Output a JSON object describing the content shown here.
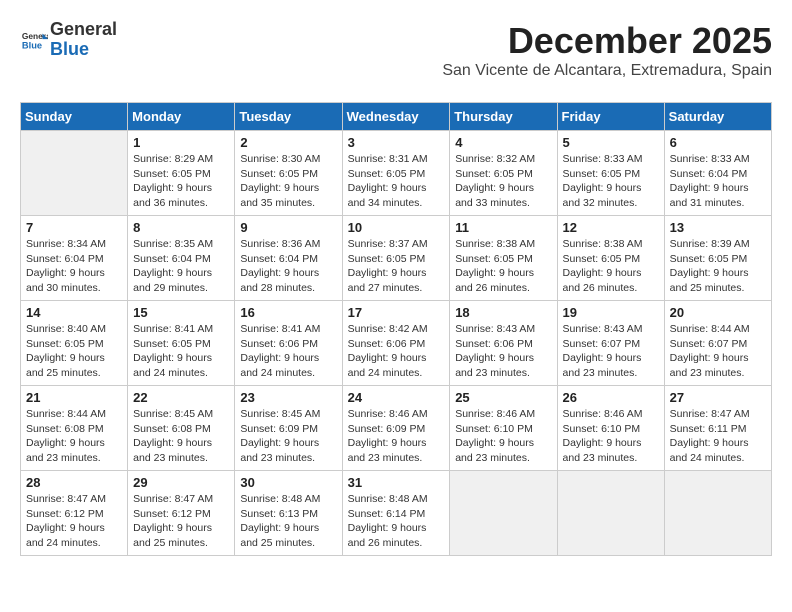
{
  "header": {
    "logo_general": "General",
    "logo_blue": "Blue",
    "month_title": "December 2025",
    "location": "San Vicente de Alcantara, Extremadura, Spain"
  },
  "weekdays": [
    "Sunday",
    "Monday",
    "Tuesday",
    "Wednesday",
    "Thursday",
    "Friday",
    "Saturday"
  ],
  "weeks": [
    [
      {
        "day": "",
        "info": ""
      },
      {
        "day": "1",
        "info": "Sunrise: 8:29 AM\nSunset: 6:05 PM\nDaylight: 9 hours\nand 36 minutes."
      },
      {
        "day": "2",
        "info": "Sunrise: 8:30 AM\nSunset: 6:05 PM\nDaylight: 9 hours\nand 35 minutes."
      },
      {
        "day": "3",
        "info": "Sunrise: 8:31 AM\nSunset: 6:05 PM\nDaylight: 9 hours\nand 34 minutes."
      },
      {
        "day": "4",
        "info": "Sunrise: 8:32 AM\nSunset: 6:05 PM\nDaylight: 9 hours\nand 33 minutes."
      },
      {
        "day": "5",
        "info": "Sunrise: 8:33 AM\nSunset: 6:05 PM\nDaylight: 9 hours\nand 32 minutes."
      },
      {
        "day": "6",
        "info": "Sunrise: 8:33 AM\nSunset: 6:04 PM\nDaylight: 9 hours\nand 31 minutes."
      }
    ],
    [
      {
        "day": "7",
        "info": "Sunrise: 8:34 AM\nSunset: 6:04 PM\nDaylight: 9 hours\nand 30 minutes."
      },
      {
        "day": "8",
        "info": "Sunrise: 8:35 AM\nSunset: 6:04 PM\nDaylight: 9 hours\nand 29 minutes."
      },
      {
        "day": "9",
        "info": "Sunrise: 8:36 AM\nSunset: 6:04 PM\nDaylight: 9 hours\nand 28 minutes."
      },
      {
        "day": "10",
        "info": "Sunrise: 8:37 AM\nSunset: 6:05 PM\nDaylight: 9 hours\nand 27 minutes."
      },
      {
        "day": "11",
        "info": "Sunrise: 8:38 AM\nSunset: 6:05 PM\nDaylight: 9 hours\nand 26 minutes."
      },
      {
        "day": "12",
        "info": "Sunrise: 8:38 AM\nSunset: 6:05 PM\nDaylight: 9 hours\nand 26 minutes."
      },
      {
        "day": "13",
        "info": "Sunrise: 8:39 AM\nSunset: 6:05 PM\nDaylight: 9 hours\nand 25 minutes."
      }
    ],
    [
      {
        "day": "14",
        "info": "Sunrise: 8:40 AM\nSunset: 6:05 PM\nDaylight: 9 hours\nand 25 minutes."
      },
      {
        "day": "15",
        "info": "Sunrise: 8:41 AM\nSunset: 6:05 PM\nDaylight: 9 hours\nand 24 minutes."
      },
      {
        "day": "16",
        "info": "Sunrise: 8:41 AM\nSunset: 6:06 PM\nDaylight: 9 hours\nand 24 minutes."
      },
      {
        "day": "17",
        "info": "Sunrise: 8:42 AM\nSunset: 6:06 PM\nDaylight: 9 hours\nand 24 minutes."
      },
      {
        "day": "18",
        "info": "Sunrise: 8:43 AM\nSunset: 6:06 PM\nDaylight: 9 hours\nand 23 minutes."
      },
      {
        "day": "19",
        "info": "Sunrise: 8:43 AM\nSunset: 6:07 PM\nDaylight: 9 hours\nand 23 minutes."
      },
      {
        "day": "20",
        "info": "Sunrise: 8:44 AM\nSunset: 6:07 PM\nDaylight: 9 hours\nand 23 minutes."
      }
    ],
    [
      {
        "day": "21",
        "info": "Sunrise: 8:44 AM\nSunset: 6:08 PM\nDaylight: 9 hours\nand 23 minutes."
      },
      {
        "day": "22",
        "info": "Sunrise: 8:45 AM\nSunset: 6:08 PM\nDaylight: 9 hours\nand 23 minutes."
      },
      {
        "day": "23",
        "info": "Sunrise: 8:45 AM\nSunset: 6:09 PM\nDaylight: 9 hours\nand 23 minutes."
      },
      {
        "day": "24",
        "info": "Sunrise: 8:46 AM\nSunset: 6:09 PM\nDaylight: 9 hours\nand 23 minutes."
      },
      {
        "day": "25",
        "info": "Sunrise: 8:46 AM\nSunset: 6:10 PM\nDaylight: 9 hours\nand 23 minutes."
      },
      {
        "day": "26",
        "info": "Sunrise: 8:46 AM\nSunset: 6:10 PM\nDaylight: 9 hours\nand 23 minutes."
      },
      {
        "day": "27",
        "info": "Sunrise: 8:47 AM\nSunset: 6:11 PM\nDaylight: 9 hours\nand 24 minutes."
      }
    ],
    [
      {
        "day": "28",
        "info": "Sunrise: 8:47 AM\nSunset: 6:12 PM\nDaylight: 9 hours\nand 24 minutes."
      },
      {
        "day": "29",
        "info": "Sunrise: 8:47 AM\nSunset: 6:12 PM\nDaylight: 9 hours\nand 25 minutes."
      },
      {
        "day": "30",
        "info": "Sunrise: 8:48 AM\nSunset: 6:13 PM\nDaylight: 9 hours\nand 25 minutes."
      },
      {
        "day": "31",
        "info": "Sunrise: 8:48 AM\nSunset: 6:14 PM\nDaylight: 9 hours\nand 26 minutes."
      },
      {
        "day": "",
        "info": ""
      },
      {
        "day": "",
        "info": ""
      },
      {
        "day": "",
        "info": ""
      }
    ]
  ]
}
